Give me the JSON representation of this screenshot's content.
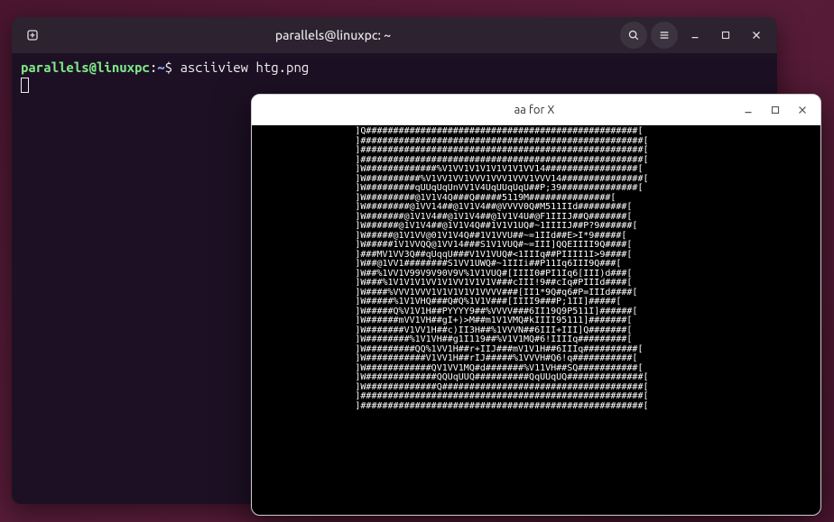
{
  "terminal": {
    "title": "parallels@linuxpc: ~",
    "prompt": {
      "user": "parallels",
      "at": "@",
      "host": "linuxpc",
      "sep1": ":",
      "path": "~",
      "sep2": "$"
    },
    "command": "asciiview htg.png"
  },
  "aa_window": {
    "title": "aa for X",
    "ascii_art": "                   ]Q##################################################[\n                   ]####################################################[\n                   ]####################################################[\n                   ]####################################################[\n                   ]W#############%V1VV1V1V1V1V1V1VV14#################[\n                   ]W##########%V1VV1VV1VVV1VVV1VVV1VVV14###############[\n                   ]W#########qUUqUqUnVV1V4UqUUqUqU##P;39##############[\n                   ]W#########@1V1V4Q###Q#####5119M###############[\n                   ]W########@1VV14##@1V1V4##@VVVV0Q#M511IId#########[\n                   ]W#######@1V1V4##@1V1V4##@1V1V4U#@F1IIIJ##Q#######[\n                   ]W######@1V1V4##@1V1V4Q##1V1V1UQ#~1IIIIJ##P?9######[\n                   ]W#####@1V1VV@01V1V4Q##1V1VVU##~=1IId##E>I*9#####[\n                   ]W#####1V1VVQQ@1VV14###S1V1VUQ#~=III]QQEIIII9Q####[\n                   ]###MV1VV3Q##qUqqU###V1V1VUQ#<1IIIq##PIIII1I>9####[\n                   ]W##@1VV1########S1VV1UWQ#~1IIIi##P11Iq6III9Q###[\n                   ]W##%1VV1V99V9V90V9V%1V1VUQ#[IIII0#PI1Iq6[III)d###[\n                   ]W###%1V1V1V1VV1V1VV1V1V1V###cIII!9##cIq#PIIId####[\n                   ]W####%VVV1VVV1V1V1V1V1VVVV###[II1*9Q#q6#P=IIId####[\n                   ]W#####%1V1VHQ###Q#Q%1V1V###[IIII9###P;1II]#####[\n                   ]W#####Q%V1V1H##PYYYY9##%VVVV###6II19Q9P511I]######[\n                   ]W######mVV1VH##gI+)>M##m1V1VMQ#kIIII95111]#######[\n                   ]W#######V1VV1H##c)II3H##%1VVVN##6III+III]Q#######[\n                   ]W########%1V1VH##g1I119##%V1V1MQ#6!IIIIq#########[\n                   ]W#########QQ%1VV1H##r+IIJ###mV1V1H##6IIIq##########[\n                   ]W###########V1VV1H##rIJ#####%1VVVH#Q6!q###########[\n                   ]W############QV1VV1MQ#d#######%V11VH##SQ###########[\n                   ]W#############QQUqUUQ##########QqUUqUQ##############[\n                   ]W#############Q#####################################[\n                   ]####################################################[\n                   ]####################################################["
  }
}
